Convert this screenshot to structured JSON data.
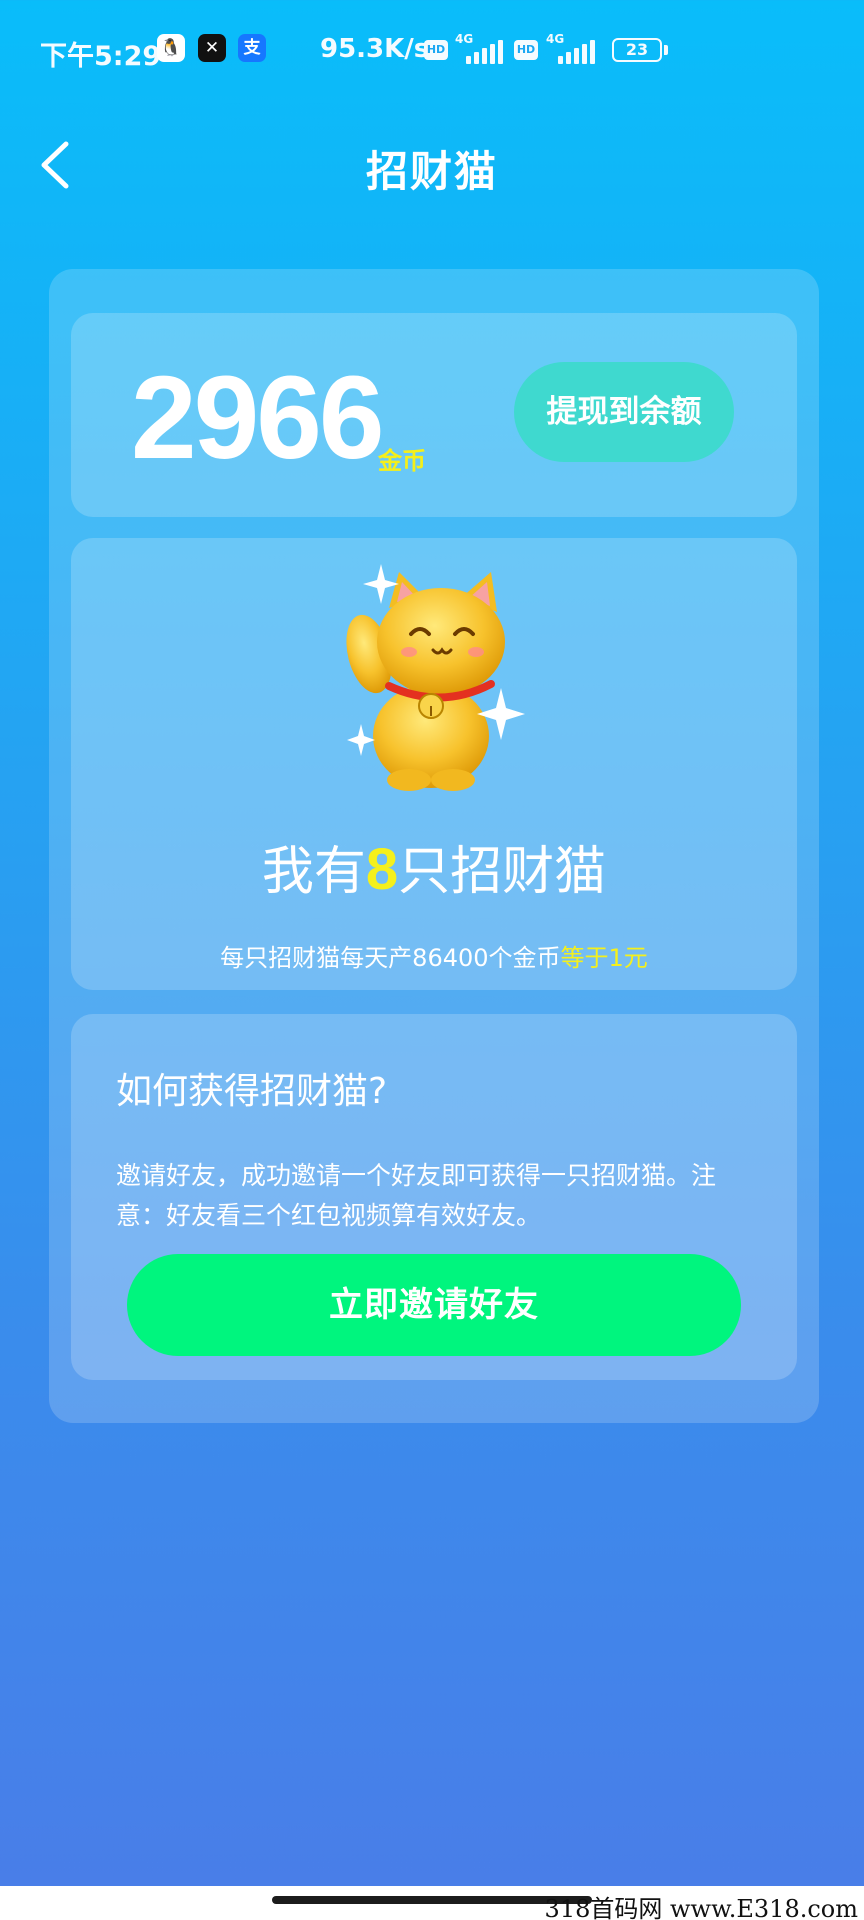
{
  "status_bar": {
    "time": "下午5:29",
    "app_icons": [
      "qq-icon",
      "capcut-icon",
      "alipay-icon"
    ],
    "qq_glyph": "🐧",
    "capcut_glyph": "✕",
    "alipay_glyph": "支",
    "network_speed": "95.3K/s",
    "hd_label": "HD",
    "network_type_1": "4G",
    "network_type_2": "4G",
    "battery_level": "23"
  },
  "header": {
    "title": "招财猫"
  },
  "coins_card": {
    "amount": "2966",
    "unit": "金币",
    "withdraw_label": "提现到余额"
  },
  "cat_card": {
    "count_prefix": "我有",
    "count_value": "8",
    "count_suffix": "只招财猫",
    "rate_text": "每只招财猫每天产86400个金币",
    "rate_highlight": "等于1元"
  },
  "info_card": {
    "title": "如何获得招财猫?",
    "description": "邀请好友，成功邀请一个好友即可获得一只招财猫。注意：好友看三个红包视频算有效好友。",
    "invite_label": "立即邀请好友"
  },
  "watermark": "318首码网 www.E318.com",
  "colors": {
    "background_top": "#09bdfa",
    "background_bottom": "#4a7de8",
    "highlight_yellow": "#f5f01c",
    "withdraw_button": "#3fd9cf",
    "invite_button": "#00f57e"
  }
}
